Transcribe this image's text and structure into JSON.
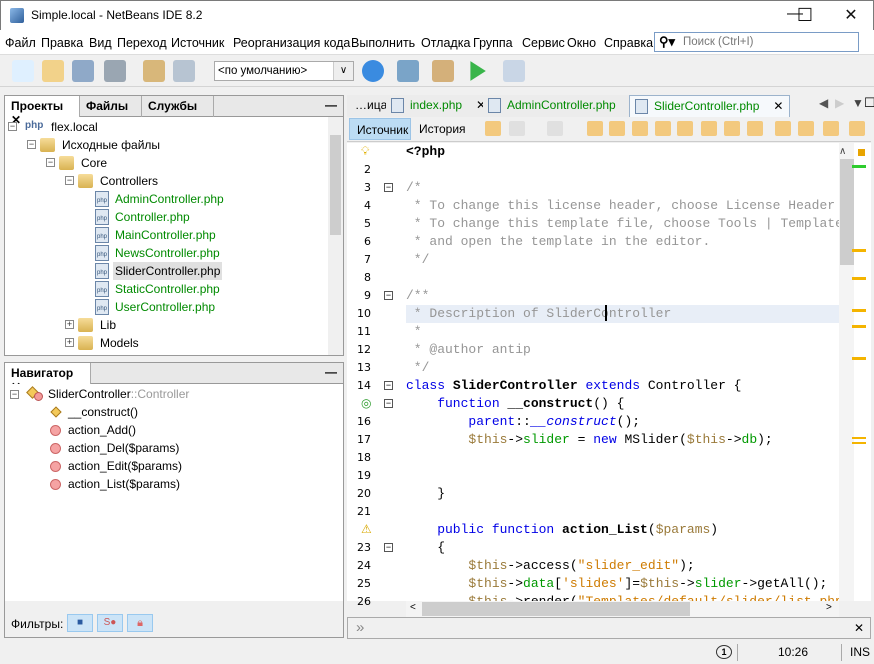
{
  "window": {
    "title": "Simple.local - NetBeans IDE 8.2",
    "minimize": "—",
    "maximize": "☐",
    "close": "✕"
  },
  "menu": [
    "Файл",
    "Правка",
    "Вид",
    "Переход",
    "Источник",
    "Реорганизация кода",
    "Выполнить",
    "Отладка",
    "Группа",
    "Сервис",
    "Окно",
    "Справка"
  ],
  "search": {
    "placeholder": "Поиск (Ctrl+I)",
    "icon": "search-icon"
  },
  "toolbar": {
    "config": "<по умолчанию>",
    "icons": [
      "new-file-icon",
      "new-project-icon",
      "open-project-icon",
      "close-project-icon",
      "undo-icon",
      "redo-icon",
      "browser-icon",
      "build-icon",
      "clean-build-icon",
      "run-icon",
      "debug-icon"
    ]
  },
  "projects": {
    "tabs": [
      "Проекты",
      "Файлы",
      "Службы"
    ],
    "nodes": [
      {
        "label": "flex.local",
        "level": 0,
        "type": "php-project",
        "exp": "−"
      },
      {
        "label": "Исходные файлы",
        "level": 1,
        "type": "source",
        "exp": "−"
      },
      {
        "label": "Core",
        "level": 2,
        "type": "folder",
        "exp": "−"
      },
      {
        "label": "Controllers",
        "level": 3,
        "type": "folder",
        "exp": "−"
      },
      {
        "label": "AdminController.php",
        "level": 4,
        "type": "php",
        "green": true
      },
      {
        "label": "Controller.php",
        "level": 4,
        "type": "php",
        "green": true
      },
      {
        "label": "MainController.php",
        "level": 4,
        "type": "php",
        "green": true
      },
      {
        "label": "NewsController.php",
        "level": 4,
        "type": "php",
        "green": true
      },
      {
        "label": "SliderController.php",
        "level": 4,
        "type": "php",
        "selected": true
      },
      {
        "label": "StaticController.php",
        "level": 4,
        "type": "php",
        "green": true
      },
      {
        "label": "UserController.php",
        "level": 4,
        "type": "php",
        "green": true
      },
      {
        "label": "Lib",
        "level": 3,
        "type": "folder",
        "exp": "+"
      },
      {
        "label": "Models",
        "level": 3,
        "type": "folder",
        "exp": "+"
      }
    ]
  },
  "navigator": {
    "title": "Навигатор",
    "class_name": "SliderController",
    "class_parent": "::Controller",
    "members": [
      {
        "label": "__construct()",
        "type": "constructor"
      },
      {
        "label": "action_Add()",
        "type": "method"
      },
      {
        "label": "action_Del($params)",
        "type": "method"
      },
      {
        "label": "action_Edit($params)",
        "type": "method"
      },
      {
        "label": "action_List($params)",
        "type": "method"
      }
    ],
    "filters_label": "Фильтры:"
  },
  "editor": {
    "tabs": [
      {
        "label": "…ица",
        "partial": true
      },
      {
        "label": "index.php",
        "green": true
      },
      {
        "label": "AdminController.php",
        "green": true
      },
      {
        "label": "SliderController.php",
        "active": true,
        "green": true
      }
    ],
    "source_tab": "Источник",
    "history_tab": "История",
    "lines": [
      {
        "n": "",
        "icon": "bulb",
        "t": [
          [
            "<?php",
            "b"
          ]
        ]
      },
      {
        "n": "2",
        "t": []
      },
      {
        "n": "3",
        "fold": true,
        "t": [
          [
            "/*",
            "cm"
          ]
        ]
      },
      {
        "n": "4",
        "t": [
          [
            " * To change this license header, choose License Header",
            "cm"
          ]
        ]
      },
      {
        "n": "5",
        "t": [
          [
            " * To change this template file, choose Tools | Templates",
            "cm"
          ]
        ]
      },
      {
        "n": "6",
        "t": [
          [
            " * and open the template in the editor.",
            "cm"
          ]
        ]
      },
      {
        "n": "7",
        "t": [
          [
            " */",
            "cm"
          ]
        ]
      },
      {
        "n": "8",
        "t": []
      },
      {
        "n": "9",
        "fold": true,
        "t": [
          [
            "/**",
            "cm"
          ]
        ]
      },
      {
        "n": "10",
        "current": true,
        "t": [
          [
            " * Description of SliderController",
            "cm"
          ]
        ]
      },
      {
        "n": "11",
        "t": [
          [
            " *",
            "cm"
          ]
        ]
      },
      {
        "n": "12",
        "t": [
          [
            " * @author antip",
            "cm"
          ]
        ]
      },
      {
        "n": "13",
        "t": [
          [
            " */",
            "cm"
          ]
        ]
      },
      {
        "n": "14",
        "fold": true,
        "t": [
          [
            "class ",
            "kw"
          ],
          [
            "SliderController ",
            "b"
          ],
          [
            "extends ",
            "kw"
          ],
          [
            "Controller {",
            ""
          ]
        ]
      },
      {
        "n": "",
        "icon": "override",
        "fold": true,
        "t": [
          [
            "    function ",
            "kw"
          ],
          [
            "__construct",
            "b"
          ],
          [
            "() {",
            ""
          ]
        ]
      },
      {
        "n": "16",
        "t": [
          [
            "        parent",
            "kw"
          ],
          [
            "::",
            ""
          ],
          [
            "__construct",
            "kw it"
          ],
          [
            "();",
            ""
          ]
        ]
      },
      {
        "n": "17",
        "t": [
          [
            "        $this",
            "var"
          ],
          [
            "->",
            ""
          ],
          [
            "slider",
            "fld"
          ],
          [
            " = ",
            ""
          ],
          [
            "new ",
            "kw"
          ],
          [
            "MSlider(",
            ""
          ],
          [
            "$this",
            "var"
          ],
          [
            "->",
            ""
          ],
          [
            "db",
            "fld"
          ],
          [
            ");",
            ""
          ]
        ]
      },
      {
        "n": "18",
        "t": []
      },
      {
        "n": "19",
        "t": []
      },
      {
        "n": "20",
        "t": [
          [
            "    }",
            ""
          ]
        ]
      },
      {
        "n": "21",
        "t": []
      },
      {
        "n": "",
        "icon": "warning",
        "t": [
          [
            "    public ",
            "kw"
          ],
          [
            "function ",
            "kw"
          ],
          [
            "action_List",
            "b"
          ],
          [
            "(",
            ""
          ],
          [
            "$params",
            "var"
          ],
          [
            ")",
            ""
          ]
        ]
      },
      {
        "n": "23",
        "fold": true,
        "t": [
          [
            "    {",
            ""
          ]
        ]
      },
      {
        "n": "24",
        "t": [
          [
            "        $this",
            "var"
          ],
          [
            "->access(",
            ""
          ],
          [
            "\"slider_edit\"",
            "str"
          ],
          [
            ");",
            ""
          ]
        ]
      },
      {
        "n": "25",
        "t": [
          [
            "        $this",
            "var"
          ],
          [
            "->",
            ""
          ],
          [
            "data",
            "fld"
          ],
          [
            "[",
            ""
          ],
          [
            "'slides'",
            "str"
          ],
          [
            "]=",
            ""
          ],
          [
            "$this",
            "var"
          ],
          [
            "->",
            ""
          ],
          [
            "slider",
            "fld"
          ],
          [
            "->getAll();",
            ""
          ]
        ]
      },
      {
        "n": "26",
        "t": [
          [
            "        $this",
            "var"
          ],
          [
            "->render(",
            ""
          ],
          [
            "\"Templates/default/slider/list.php\"",
            "str"
          ]
        ]
      }
    ]
  },
  "status": {
    "notifications": "1",
    "position": "10:26",
    "mode": "INS"
  },
  "colors": {
    "keyword": "#0000e6",
    "comment": "#969696",
    "field": "#009900",
    "string": "#ce7b00",
    "selection": "#e8eef7"
  }
}
